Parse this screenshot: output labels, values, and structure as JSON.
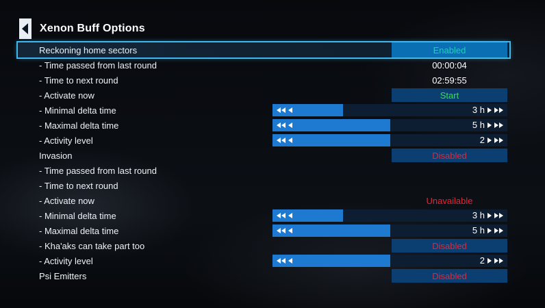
{
  "title": "Xenon Buff Options",
  "colors": {
    "accent": "#3fb8f0",
    "enabled": "#1ed0b8",
    "start": "#3cdc5a",
    "disabled": "#e0283a",
    "unavailable": "#e0283a",
    "slider_fill": "#1e7ad1",
    "toggle_bg": "#0b3f71"
  },
  "rows": [
    {
      "label": "Reckoning home sectors",
      "kind": "toggle",
      "value": "Enabled",
      "status": "enabled",
      "selected": true
    },
    {
      "label": "- Time passed from last round",
      "kind": "text",
      "value": "00:00:04"
    },
    {
      "label": "- Time to next round",
      "kind": "text",
      "value": "02:59:55"
    },
    {
      "label": "- Activate now",
      "kind": "toggle",
      "value": "Start",
      "status": "start"
    },
    {
      "label": "- Minimal delta time",
      "kind": "slider",
      "value": "3 h",
      "fill_fraction": 0.3
    },
    {
      "label": "- Maximal delta time",
      "kind": "slider",
      "value": "5 h",
      "fill_fraction": 0.5
    },
    {
      "label": "- Activity level",
      "kind": "slider",
      "value": "2",
      "fill_fraction": 0.5
    },
    {
      "label": "Invasion",
      "kind": "toggle",
      "value": "Disabled",
      "status": "disabled"
    },
    {
      "label": "- Time passed from last round",
      "kind": "text",
      "value": ""
    },
    {
      "label": "- Time to next round",
      "kind": "text",
      "value": ""
    },
    {
      "label": "- Activate now",
      "kind": "plain",
      "value": "Unavailable",
      "status": "unavailable"
    },
    {
      "label": "- Minimal delta time",
      "kind": "slider",
      "value": "3 h",
      "fill_fraction": 0.3
    },
    {
      "label": "- Maximal delta time",
      "kind": "slider",
      "value": "5 h",
      "fill_fraction": 0.5
    },
    {
      "label": "- Kha'aks can take part too",
      "kind": "toggle",
      "value": "Disabled",
      "status": "disabled"
    },
    {
      "label": "- Activity level",
      "kind": "slider",
      "value": "2",
      "fill_fraction": 0.5
    },
    {
      "label": "Psi Emitters",
      "kind": "toggle",
      "value": "Disabled",
      "status": "disabled"
    }
  ]
}
